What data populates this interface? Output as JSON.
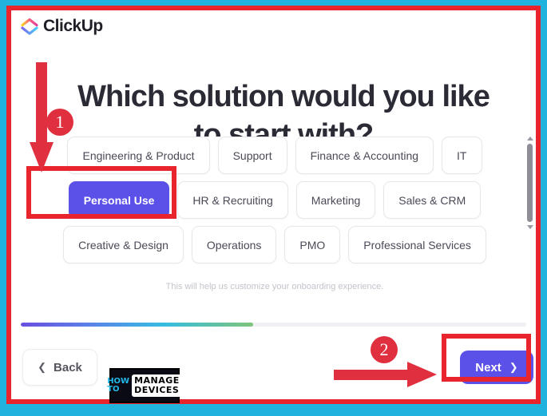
{
  "app": {
    "brand_name": "ClickUp",
    "logo_icon": "clickup-arrow-logo"
  },
  "heading": {
    "line1": "Which solution would you like",
    "line2": "to start with?"
  },
  "options": {
    "rows": [
      [
        {
          "label": "Engineering & Product",
          "selected": false
        },
        {
          "label": "Support",
          "selected": false
        },
        {
          "label": "Finance & Accounting",
          "selected": false
        },
        {
          "label": "IT",
          "selected": false
        }
      ],
      [
        {
          "label": "Personal Use",
          "selected": true
        },
        {
          "label": "HR & Recruiting",
          "selected": false
        },
        {
          "label": "Marketing",
          "selected": false
        },
        {
          "label": "Sales & CRM",
          "selected": false
        }
      ],
      [
        {
          "label": "Creative & Design",
          "selected": false
        },
        {
          "label": "Operations",
          "selected": false
        },
        {
          "label": "PMO",
          "selected": false
        },
        {
          "label": "Professional Services",
          "selected": false
        }
      ]
    ],
    "helper_text": "This will help us customize your onboarding experience."
  },
  "footer": {
    "back_label": "Back",
    "back_icon": "chevron-left-icon",
    "next_label": "Next",
    "next_icon": "chevron-right-icon",
    "progress_percent": 46
  },
  "scrollbar": {
    "up_icon": "scroll-up-arrow-icon",
    "down_icon": "scroll-down-arrow-icon"
  },
  "annotations": {
    "badge_1": "1",
    "badge_2": "2",
    "arrow_down_icon": "red-down-arrow-icon",
    "arrow_right_icon": "red-right-arrow-icon"
  },
  "watermark": {
    "how": "HOW",
    "to": "TO",
    "manage": "MANAGE",
    "devices": "DEVICES"
  },
  "colors": {
    "frame_outer": "#1fb3dd",
    "frame_inner": "#e8242c",
    "accent_purple": "#5b50e8",
    "annotation_red": "#e03040"
  }
}
